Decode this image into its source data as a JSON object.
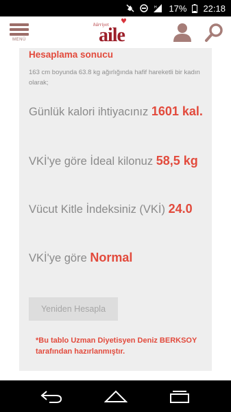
{
  "status_bar": {
    "battery": "17%",
    "time": "22:18"
  },
  "header": {
    "menu_label": "MENÜ",
    "logo_small": "hürriyet",
    "logo_big": "aile"
  },
  "result": {
    "title": "Hesaplama sonucu",
    "description": "163 cm boyunda 63.8 kg ağırlığında hafif hareketli bir kadın olarak;",
    "calorie_text": "Günlük kalori ihtiyacınız ",
    "calorie_value": "1601 kal.",
    "ideal_text": "VKİ'ye göre İdeal kilonuz ",
    "ideal_value": "58,5 kg",
    "bmi_text": "Vücut Kitle İndeksiniz (VKİ) ",
    "bmi_value": "24.0",
    "category_text": "VKİ'ye göre ",
    "category_value": "Normal",
    "recalc_button": "Yeniden Hesapla",
    "note": "*Bu tablo Uzman Diyetisyen Deniz BERKSOY tarafından hazırlanmıştır."
  },
  "colors": {
    "accent": "#e24a3c",
    "brand": "#9c6d69"
  },
  "icons": {
    "status": [
      "mute-icon",
      "dnd-icon",
      "signal-icon",
      "battery-icon"
    ],
    "nav": [
      "back-icon",
      "home-icon",
      "recent-apps-icon"
    ]
  }
}
